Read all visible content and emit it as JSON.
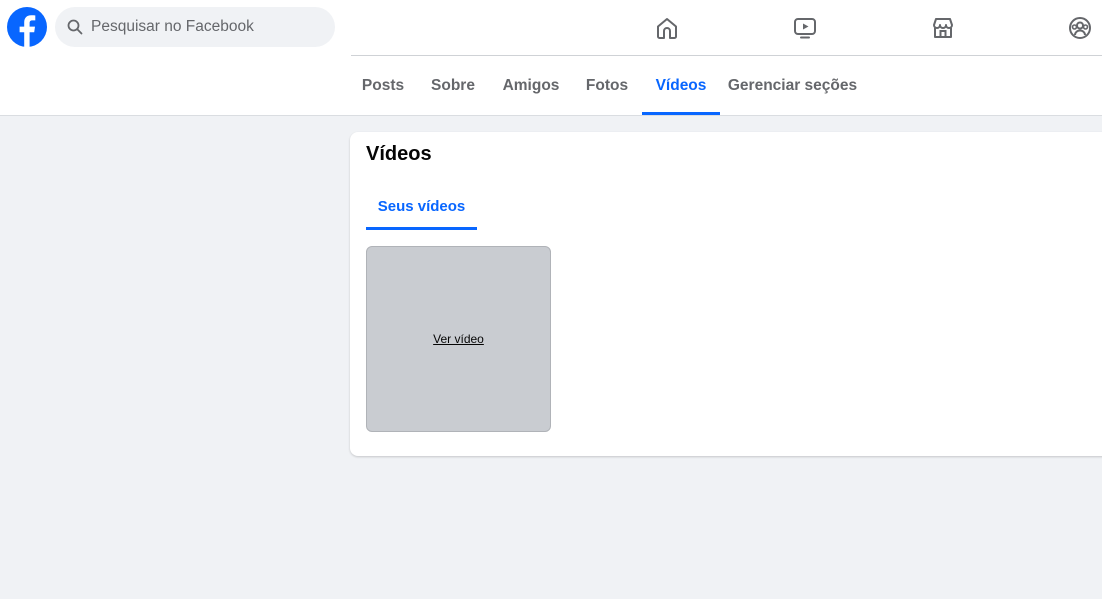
{
  "search": {
    "placeholder": "Pesquisar no Facebook"
  },
  "nav": {
    "icons": [
      "home-icon",
      "video-icon",
      "marketplace-icon",
      "groups-icon"
    ]
  },
  "tabs": [
    {
      "label": "Posts",
      "active": false
    },
    {
      "label": "Sobre",
      "active": false
    },
    {
      "label": "Amigos",
      "active": false
    },
    {
      "label": "Fotos",
      "active": false
    },
    {
      "label": "Vídeos",
      "active": true
    },
    {
      "label": "Gerenciar seções",
      "active": false
    }
  ],
  "videos_section": {
    "title": "Vídeos",
    "subtab": "Seus vídeos",
    "video_items": [
      {
        "link_label": "Ver vídeo"
      }
    ]
  },
  "colors": {
    "accent": "#0866ff",
    "background": "#f0f2f5",
    "icon": "#65676b",
    "tile": "#c9ccd1"
  }
}
